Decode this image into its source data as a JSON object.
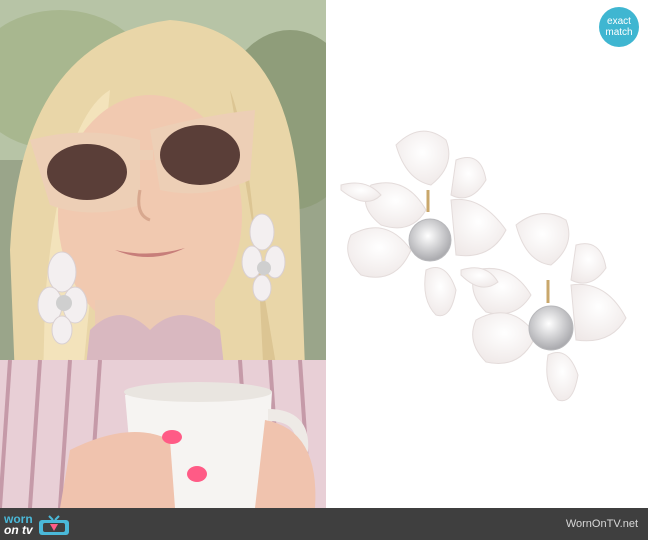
{
  "badge": {
    "line1": "exact",
    "line2": "match",
    "color": "#3fb6d1"
  },
  "footer": {
    "logo_worn": "worn",
    "logo_on": "on tv",
    "site": "WornOnTV.net",
    "background": "#3f3f3f",
    "accent": "#4ab8d8"
  },
  "icons": {
    "tv": "tv-icon"
  }
}
